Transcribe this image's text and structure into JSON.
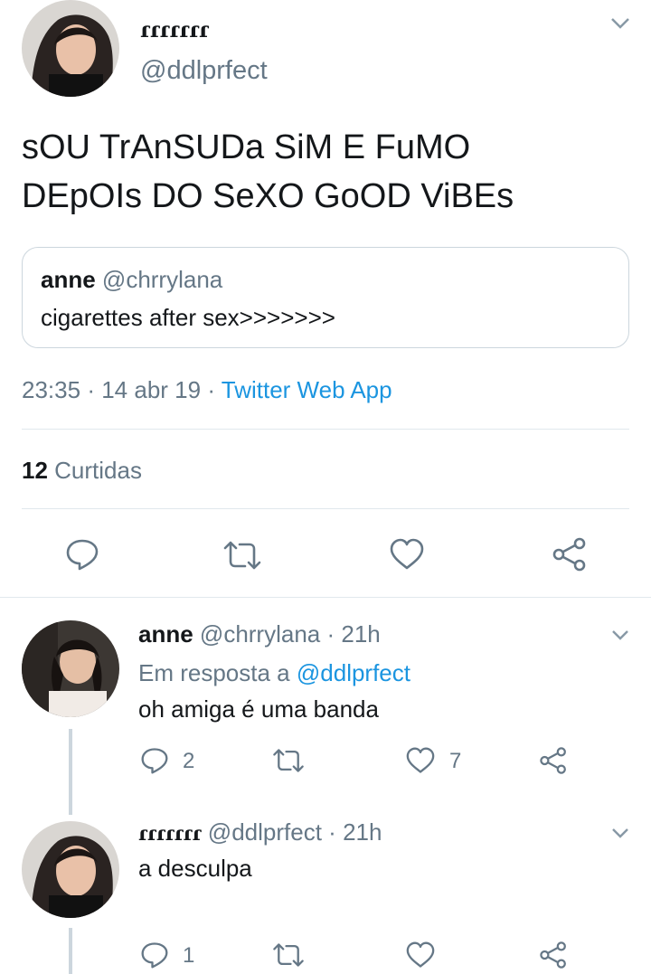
{
  "main_tweet": {
    "display_name": "ɾɾɾɾɾɾɾ",
    "handle": "@ddlprfect",
    "text_line1": "sOU TrAnSUDa SiM E FuMO",
    "text_line2": "DEpOIs DO SeXO GoOD ViBEs",
    "quote": {
      "display_name": "anne",
      "handle": "@chrrylana",
      "text": "cigarettes after sex>>>>>>>"
    },
    "time": "23:35",
    "date": "14 abr 19",
    "source": "Twitter Web App",
    "likes_count": "12",
    "likes_label": "Curtidas"
  },
  "replies": [
    {
      "display_name": "anne",
      "handle": "@chrrylana",
      "time_ago": "21h",
      "in_reply_prefix": "Em resposta a",
      "in_reply_handle": "@ddlprfect",
      "text": "oh amiga é uma banda",
      "reply_count": "2",
      "retweet_count": "",
      "like_count": "7"
    },
    {
      "display_name": "ɾɾɾɾɾɾɾ",
      "handle": "@ddlprfect",
      "time_ago": "21h",
      "text": "a desculpa",
      "reply_count": "1",
      "retweet_count": "",
      "like_count": ""
    }
  ],
  "separator": "·",
  "colors": {
    "text": "#14171a",
    "muted": "#657786",
    "link": "#1b95e0",
    "divider": "#e1e8ed"
  }
}
